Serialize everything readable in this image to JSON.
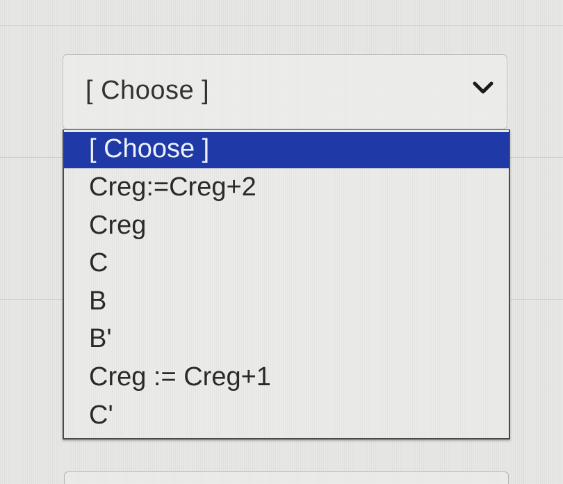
{
  "select": {
    "current_value": "[ Choose ]",
    "icon": "chevron-down-icon"
  },
  "dropdown": {
    "options": [
      {
        "label": "[ Choose ]",
        "selected": true
      },
      {
        "label": "Creg:=Creg+2",
        "selected": false
      },
      {
        "label": "Creg",
        "selected": false
      },
      {
        "label": "C",
        "selected": false
      },
      {
        "label": "B",
        "selected": false
      },
      {
        "label": "B'",
        "selected": false
      },
      {
        "label": "Creg := Creg+1",
        "selected": false
      },
      {
        "label": "C'",
        "selected": false
      }
    ]
  },
  "colors": {
    "highlight": "#1f3aa6",
    "highlight_text": "#eef2ff",
    "text": "#2a2a2a",
    "background": "#e7e7e5"
  }
}
